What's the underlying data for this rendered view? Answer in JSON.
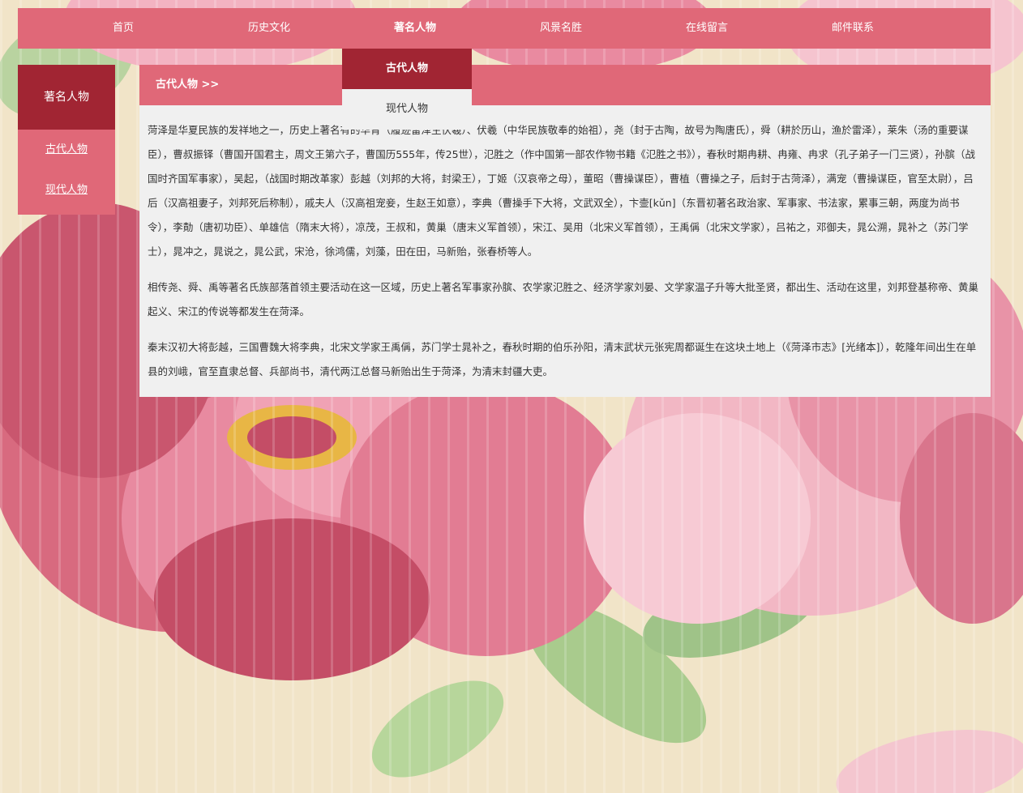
{
  "nav": {
    "items": [
      "首页",
      "历史文化",
      "著名人物",
      "风景名胜",
      "在线留言",
      "邮件联系"
    ],
    "active_index": 2,
    "dropdown": [
      "古代人物",
      "现代人物"
    ]
  },
  "sidebar": {
    "title": "著名人物",
    "items": [
      "古代人物",
      "现代人物"
    ]
  },
  "content": {
    "breadcrumb": "古代人物 >>",
    "paragraphs": [
      "菏泽是华夏民族的发祥地之一，历史上著名有的华胥（履迹雷泽生伏羲）、伏羲（中华民族敬奉的始祖），尧（封于古陶，故号为陶唐氏），舜（耕於历山，渔於雷泽），莱朱（汤的重要谋臣），曹叔振铎（曹国开国君主，周文王第六子，曹国历555年，传25世），氾胜之（作中国第一部农作物书籍《氾胜之书》），春秋时期冉耕、冉雍、冉求（孔子弟子一门三贤），孙膑（战国时齐国军事家），吴起，（战国时期改革家）彭越（刘邦的大将，封梁王），丁姬（汉哀帝之母），董昭（曹操谋臣），曹植（曹操之子，后封于古菏泽），满宠（曹操谋臣，官至太尉），吕后（汉高祖妻子，刘邦死后称制），戚夫人（汉高祖宠妾，生赵王如意），李典（曹操手下大将，文武双全），卞壸[kǔn]（东晋初著名政治家、军事家、书法家，累事三朝，两度为尚书令），李勣（唐初功臣）、单雄信（隋末大将），凉茂，王叔和，黄巢（唐末义军首领），宋江、吴用（北宋义军首领），王禹偁（北宋文学家），吕祐之，邓御夫，晁公溯，晁补之（苏门学士），晁冲之，晁说之，晁公武，宋沧，徐鸿儒，刘藻，田在田，马新贻，张春桥等人。",
      "相传尧、舜、禹等著名氏族部落首领主要活动在这一区域，历史上著名军事家孙膑、农学家氾胜之、经济学家刘晏、文学家温子升等大批圣贤，都出生、活动在这里，刘邦登基称帝、黄巢起义、宋江的传说等都发生在菏泽。",
      "秦末汉初大将彭越，三国曹魏大将李典，北宋文学家王禹偁，苏门学士晁补之，春秋时期的伯乐孙阳，清末武状元张宪周都诞生在这块土地上（《菏泽市志》[光绪本]），乾隆年间出生在单县的刘峨，官至直隶总督、兵部尚书，清代两江总督马新贻出生于菏泽，为清末封疆大吏。"
    ]
  },
  "colors": {
    "primary": "#e06878",
    "dark": "#a12533",
    "panel_bg": "#f0f0f0",
    "page_bg": "#f1e4c8"
  }
}
